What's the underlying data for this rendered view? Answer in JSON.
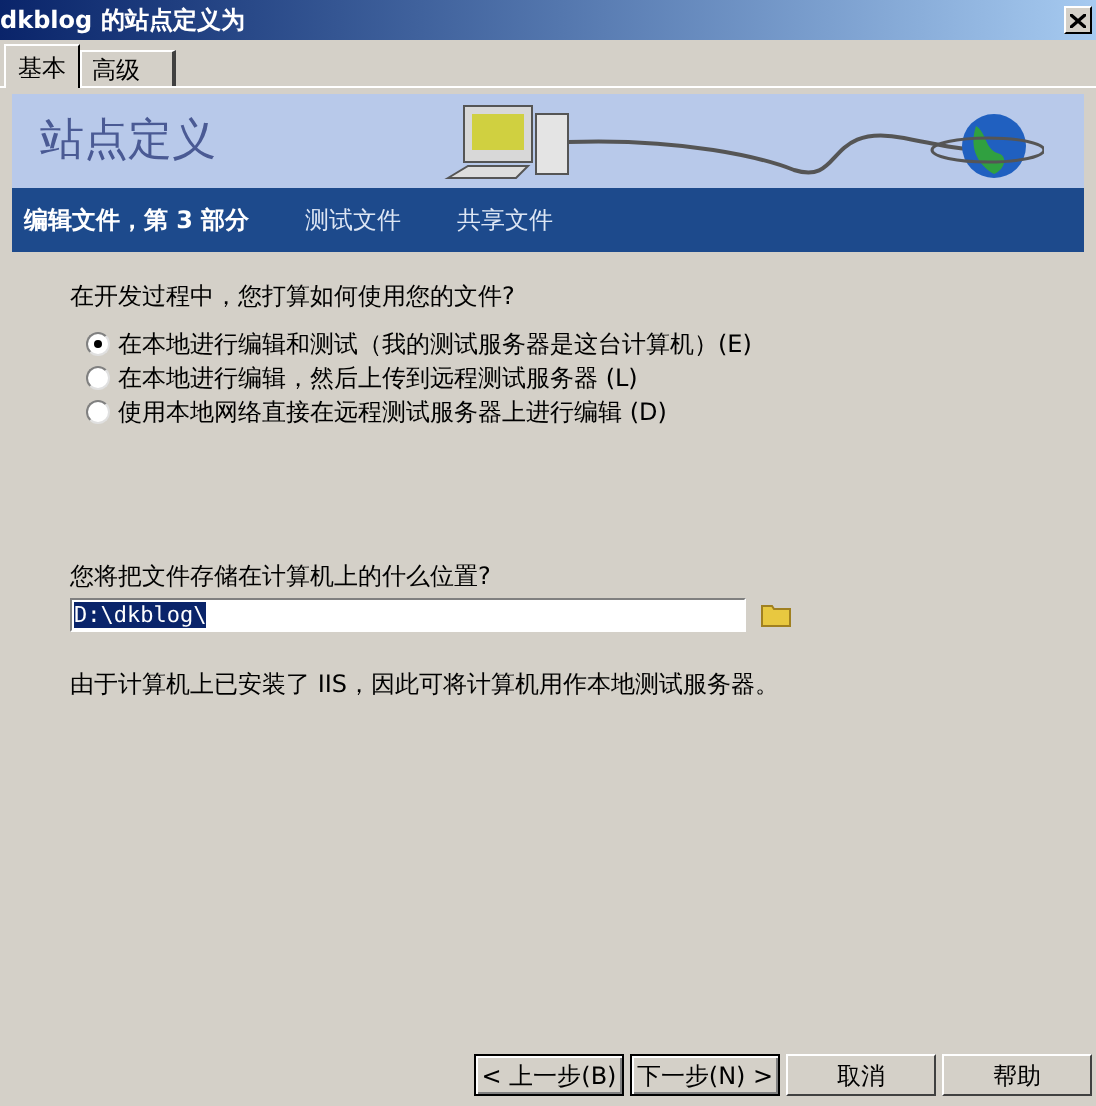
{
  "window": {
    "title": "dkblog 的站点定义为"
  },
  "tabs": [
    {
      "label": "基本",
      "selected": true
    },
    {
      "label": "高级",
      "selected": false
    }
  ],
  "banner": {
    "title": "站点定义"
  },
  "steps": [
    {
      "label": "编辑文件，第 3 部分",
      "selected": true
    },
    {
      "label": "测试文件",
      "selected": false
    },
    {
      "label": "共享文件",
      "selected": false
    }
  ],
  "question": "在开发过程中，您打算如何使用您的文件?",
  "options": [
    {
      "label": "在本地进行编辑和测试（我的测试服务器是这台计算机）(E)",
      "selected": true
    },
    {
      "label": "在本地进行编辑，然后上传到远程测试服务器 (L)",
      "selected": false
    },
    {
      "label": "使用本地网络直接在远程测试服务器上进行编辑 (D)",
      "selected": false
    }
  ],
  "location": {
    "label": "您将把文件存储在计算机上的什么位置?",
    "value": "D:\\dkblog\\"
  },
  "note": "由于计算机上已安装了 IIS，因此可将计算机用作本地测试服务器。",
  "buttons": [
    "< 上一步(B)",
    "下一步(N) >",
    "取消",
    "帮助"
  ]
}
